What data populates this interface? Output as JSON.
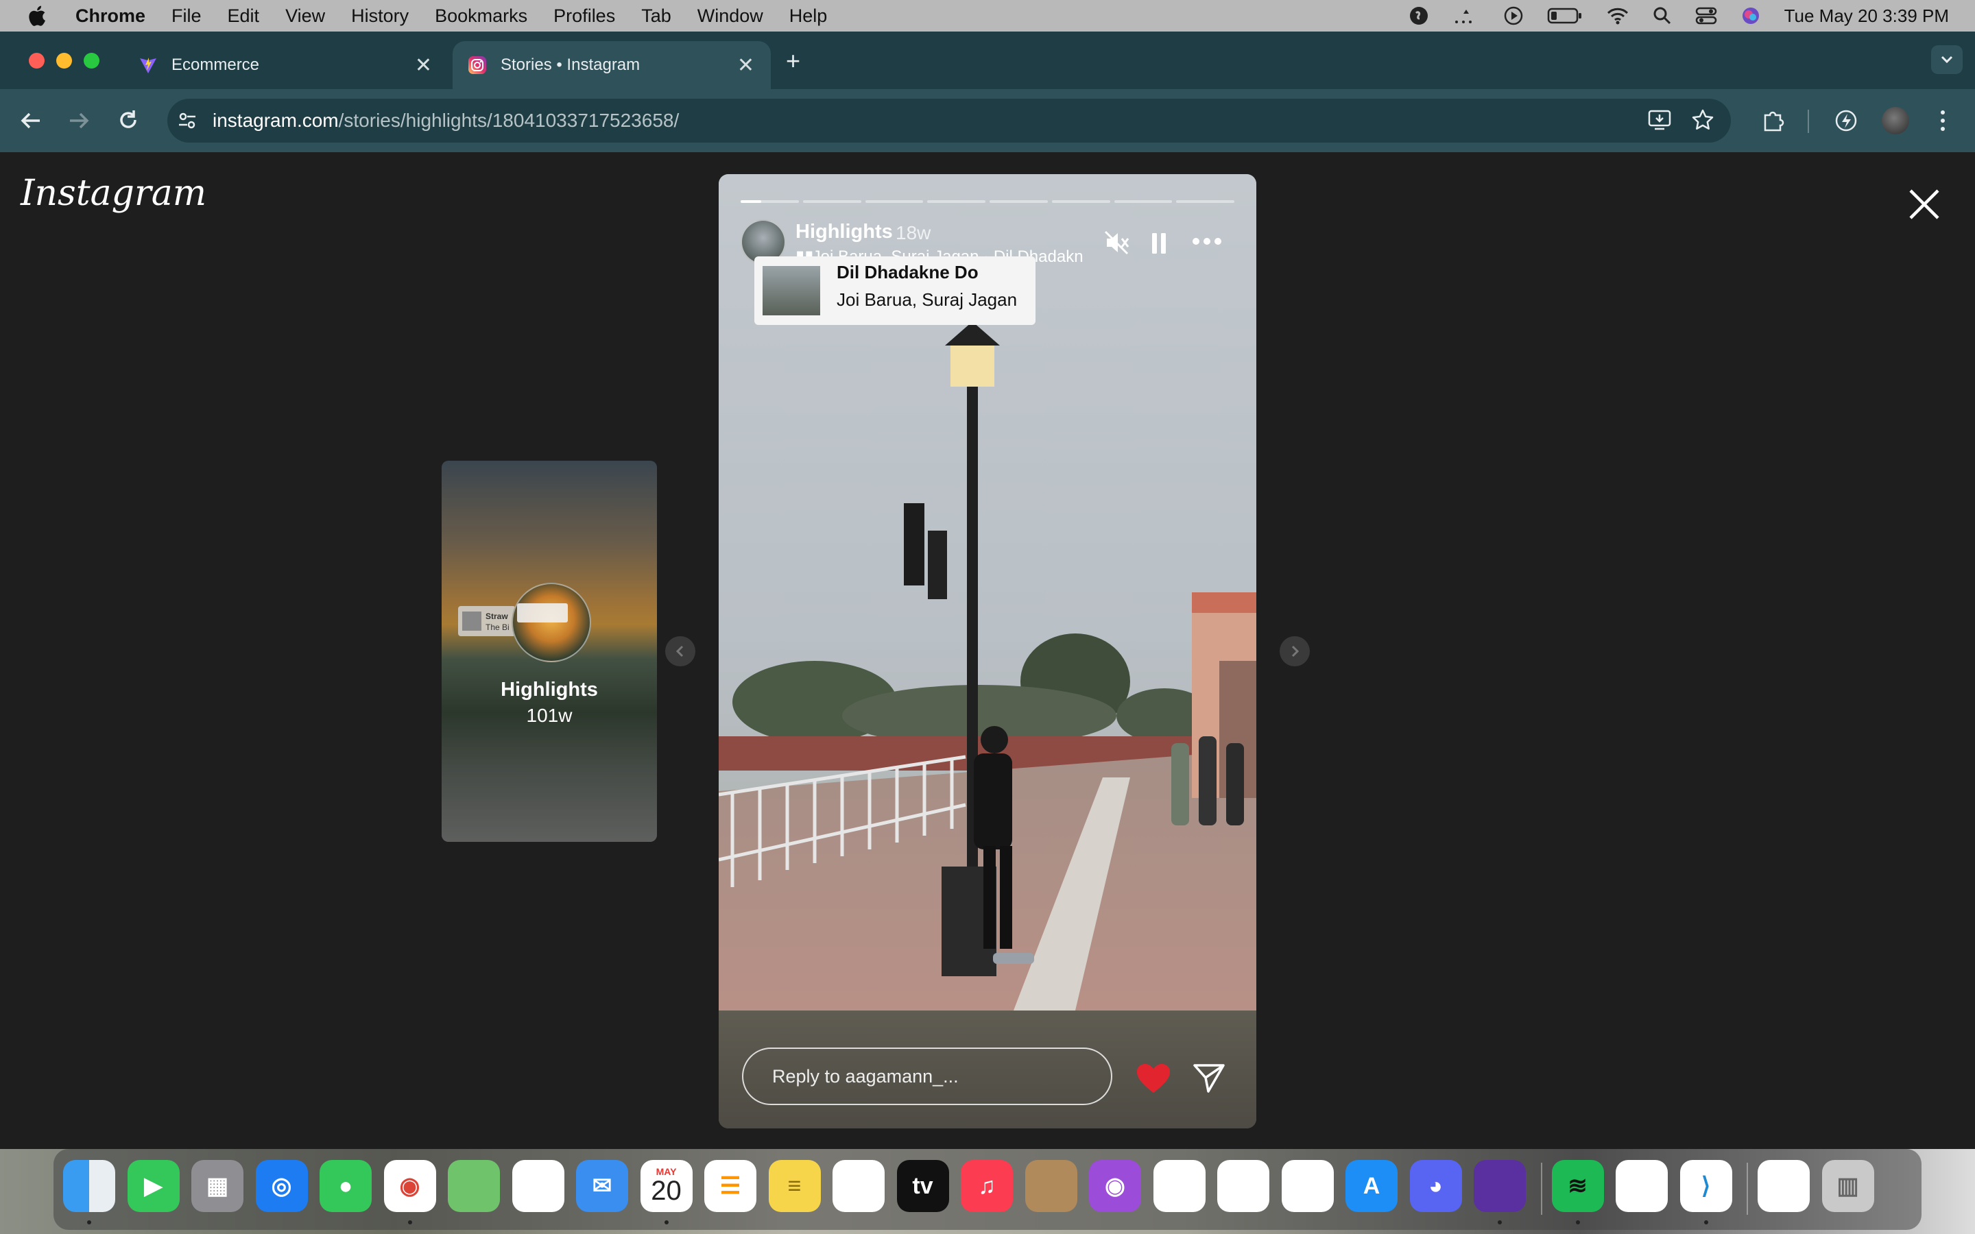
{
  "menubar": {
    "app": "Chrome",
    "items": [
      "File",
      "Edit",
      "View",
      "History",
      "Bookmarks",
      "Profiles",
      "Tab",
      "Window",
      "Help"
    ],
    "clock": "Tue May 20  3:39 PM"
  },
  "tabs": [
    {
      "title": "Ecommerce",
      "icon": "vite-logo-icon"
    },
    {
      "title": "Stories • Instagram",
      "icon": "instagram-icon"
    }
  ],
  "omnibox": {
    "host": "instagram.com",
    "path": "/stories/highlights/18041033717523658/"
  },
  "instagram": {
    "logo": "Instagram"
  },
  "prev_card": {
    "title": "Highlights",
    "age": "101w",
    "sticker_text": "Straw",
    "sticker_sub": "The Bi"
  },
  "story": {
    "user": "Highlights",
    "age": "18w",
    "music_line": "Joi Barua, Suraj Jagan · Dil Dhadakne Do",
    "sticker": {
      "song": "Dil Dhadakne Do",
      "artist": "Joi Barua, Suraj Jagan"
    },
    "progress_segments": 8,
    "progress_first_fill": 0.35,
    "reply_placeholder": "Reply to aagamann_..."
  },
  "dock": {
    "calendar_month": "MAY",
    "calendar_day": "20",
    "apps": [
      "finder-icon",
      "facetime-icon",
      "launchpad-icon",
      "safari-icon",
      "messages-icon",
      "chrome-icon",
      "maps-icon",
      "photos-icon",
      "mail-icon",
      "calendar-icon",
      "reminders-icon",
      "notes-icon",
      "freeform-icon",
      "appletv-icon",
      "music-icon",
      "contacts-icon",
      "podcasts-icon",
      "keynote-icon",
      "numbers-icon",
      "pages-icon",
      "appstore-icon",
      "discord-icon",
      "firefox-icon",
      "spotify-icon",
      "textedit-icon",
      "vscode-icon",
      "preview-icon",
      "trash-icon"
    ]
  }
}
